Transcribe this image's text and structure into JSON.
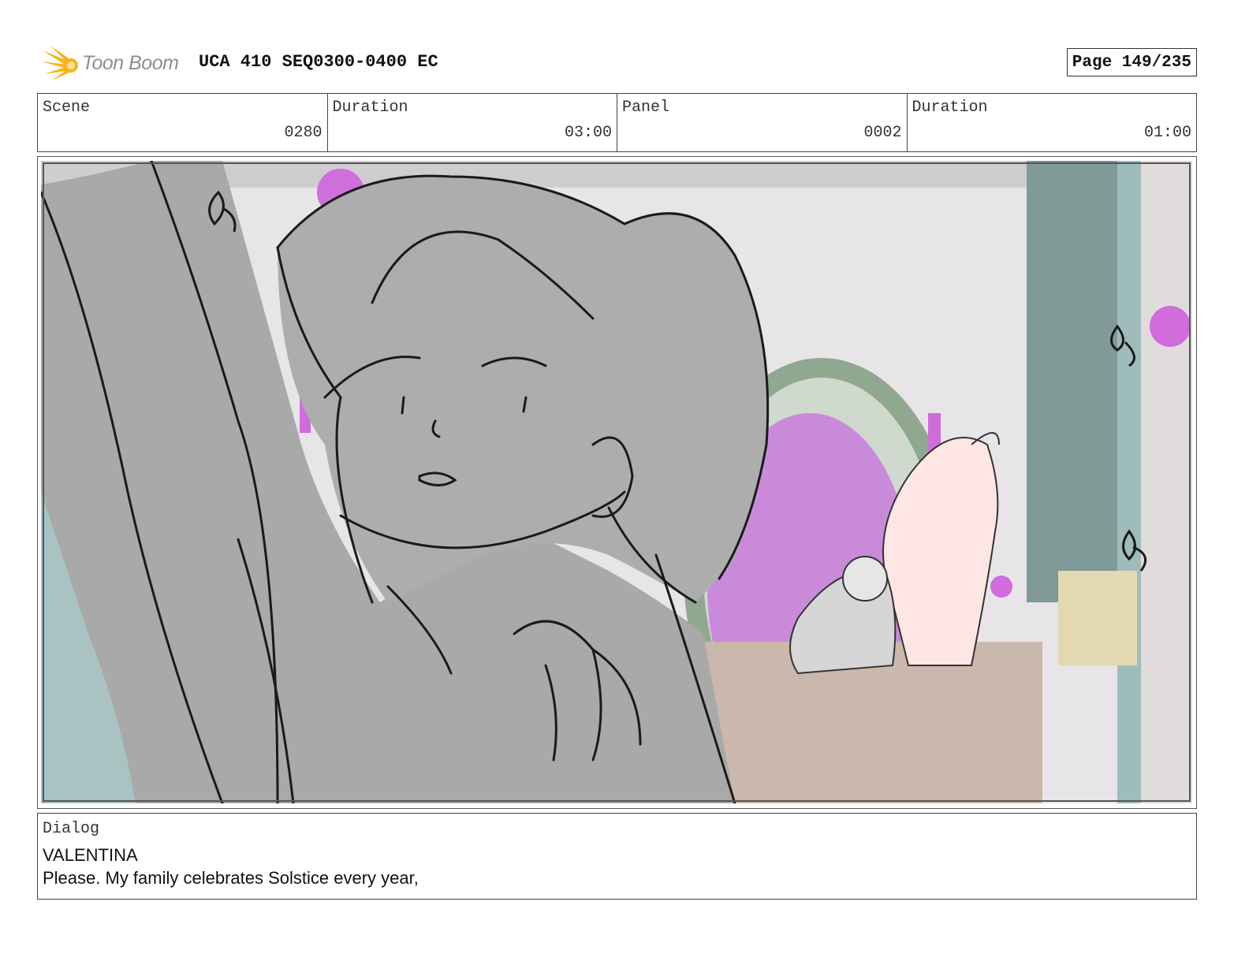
{
  "header": {
    "logo_text": "Toon Boom",
    "logo_icon": "starburst-icon",
    "doc_title": "UCA 410 SEQ0300-0400 EC",
    "page_label": "Page 149/235"
  },
  "meta": [
    {
      "label": "Scene",
      "value": "0280"
    },
    {
      "label": "Duration",
      "value": "03:00"
    },
    {
      "label": "Panel",
      "value": "0002"
    },
    {
      "label": "Duration",
      "value": "01:00"
    }
  ],
  "dialog": {
    "label": "Dialog",
    "speaker": "VALENTINA",
    "line": "Please. My family celebrates Solstice every year,"
  },
  "colors": {
    "logo_orange": "#f6b31d",
    "sketch_gray": "#a9a9a9",
    "magenta_window": "#c98bd9",
    "teal_pillar": "#9fbcbc",
    "horse_pink": "#fde6e4"
  }
}
